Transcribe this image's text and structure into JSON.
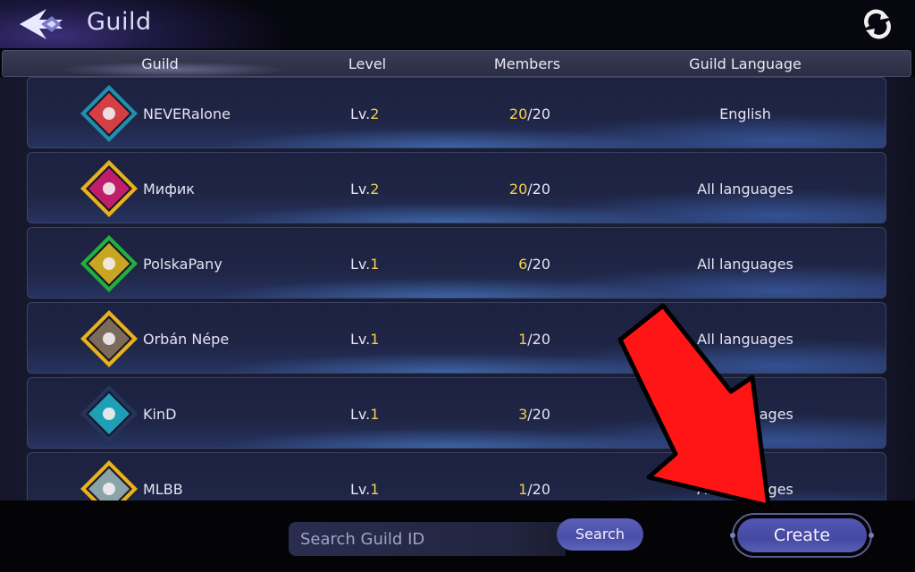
{
  "header": {
    "title": "Guild",
    "back_icon": "chevron-left-wings-icon",
    "refresh_icon": "refresh-icon"
  },
  "table": {
    "columns": [
      "Guild",
      "Level",
      "Members",
      "Guild Language"
    ],
    "level_prefix": "Lv.",
    "rows": [
      {
        "name": "NEVERalone",
        "level": "2",
        "members_current": "20",
        "members_max": "/20",
        "language": "English",
        "emblem": "crown-emblem-icon",
        "frame_color": "#1f8fb0",
        "inner_color": "#d43f45"
      },
      {
        "name": "Мифик",
        "level": "2",
        "members_current": "20",
        "members_max": "/20",
        "language": "All languages",
        "emblem": "demon-cat-emblem-icon",
        "frame_color": "#e8b21c",
        "inner_color": "#c01e6a"
      },
      {
        "name": "PolskaPany",
        "level": "1",
        "members_current": "6",
        "members_max": "/20",
        "language": "All languages",
        "emblem": "wolf-emblem-icon",
        "frame_color": "#1fb040",
        "inner_color": "#c9a524"
      },
      {
        "name": "Orbán Népe",
        "level": "1",
        "members_current": "1",
        "members_max": "/20",
        "language": "All languages",
        "emblem": "spiral-emblem-icon",
        "frame_color": "#e8b21c",
        "inner_color": "#7a6b5a"
      },
      {
        "name": "KinD",
        "level": "1",
        "members_current": "3",
        "members_max": "/20",
        "language": "All languages",
        "emblem": "horned-skull-emblem-icon",
        "frame_color": "#24345a",
        "inner_color": "#1e9fb8"
      },
      {
        "name": "MLBB",
        "level": "1",
        "members_current": "1",
        "members_max": "/20",
        "language": "All languages",
        "emblem": "dragon-emblem-icon",
        "frame_color": "#e8b21c",
        "inner_color": "#8aa3a8"
      }
    ]
  },
  "footer": {
    "search_placeholder": "Search Guild ID",
    "search_label": "Search",
    "create_label": "Create"
  },
  "overlay": {
    "annotation": "red-arrow-pointing-to-create",
    "color": "#ff1010"
  }
}
